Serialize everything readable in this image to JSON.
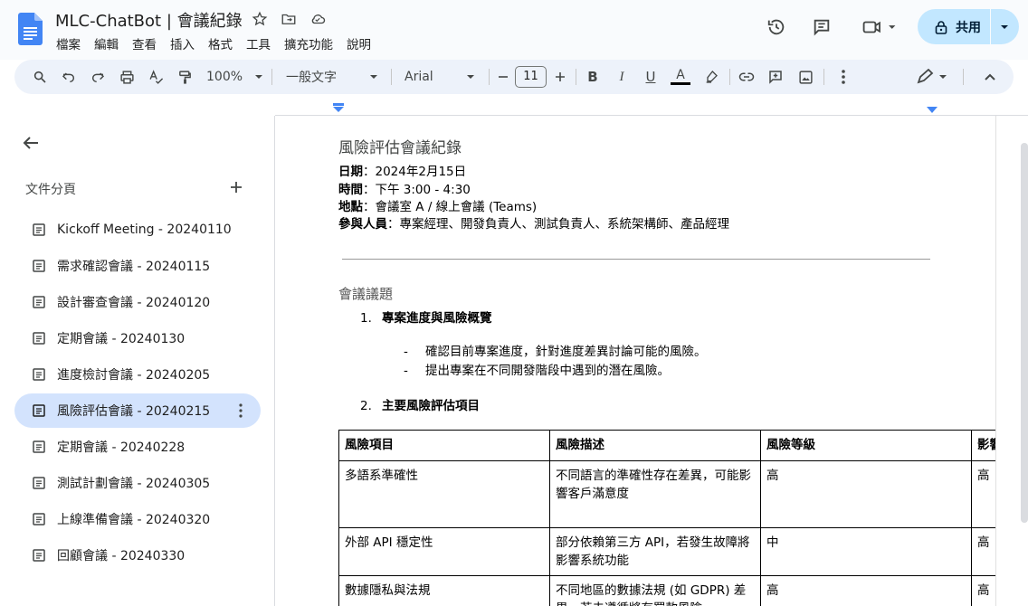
{
  "app": {
    "doc_title": "MLC-ChatBot | 會議紀錄",
    "menu": [
      "檔案",
      "編輯",
      "查看",
      "插入",
      "格式",
      "工具",
      "擴充功能",
      "說明"
    ],
    "share_label": "共用",
    "brand_color": "#4285f4"
  },
  "toolbar": {
    "zoom": "100%",
    "style": "一般文字",
    "font": "Arial",
    "font_size": "11"
  },
  "sidebar": {
    "title": "文件分頁",
    "items": [
      {
        "label": "Kickoff Meeting - 20240110",
        "active": false
      },
      {
        "label": "需求確認會議 - 20240115",
        "active": false
      },
      {
        "label": "設計審查會議 - 20240120",
        "active": false
      },
      {
        "label": "定期會議 - 20240130",
        "active": false
      },
      {
        "label": "進度檢討會議 - 20240205",
        "active": false
      },
      {
        "label": "風險評估會議 - 20240215",
        "active": true
      },
      {
        "label": "定期會議 - 20240228",
        "active": false
      },
      {
        "label": "測試計劃會議 - 20240305",
        "active": false
      },
      {
        "label": "上線準備會議 - 20240320",
        "active": false
      },
      {
        "label": "回顧會議 - 20240330",
        "active": false
      }
    ]
  },
  "doc": {
    "heading": "風險評估會議紀錄",
    "meta": [
      {
        "key": "日期",
        "value": "：2024年2月15日"
      },
      {
        "key": "時間",
        "value": "：下午 3:00 - 4:30"
      },
      {
        "key": "地點",
        "value": "：會議室 A / 線上會議 (Teams)"
      },
      {
        "key": "參與人員",
        "value": "：專案經理、開發負責人、測試負責人、系統架構師、產品經理"
      }
    ],
    "section_title": "會議議題",
    "list": [
      {
        "num": "1.",
        "text": "專案進度與風險概覽"
      },
      {
        "num": "2.",
        "text": "主要風險評估項目"
      }
    ],
    "bullets": [
      "確認目前專案進度，針對進度差異討論可能的風險。",
      "提出專案在不同開發階段中遇到的潛在風險。"
    ],
    "table": {
      "headers": [
        "風險項目",
        "風險描述",
        "風險等級",
        "影響"
      ],
      "rows": [
        [
          "多語系準確性",
          "不同語言的準確性存在差異，可能影響客戶滿意度",
          "高",
          "高"
        ],
        [
          "外部 API 穩定性",
          "部分依賴第三方 API，若發生故障將影響系統功能",
          "中",
          "高"
        ],
        [
          "數據隱私與法規",
          "不同地區的數據法規 (如 GDPR) 差異，若未遵循將有罰款風險",
          "高",
          "高"
        ]
      ]
    }
  }
}
